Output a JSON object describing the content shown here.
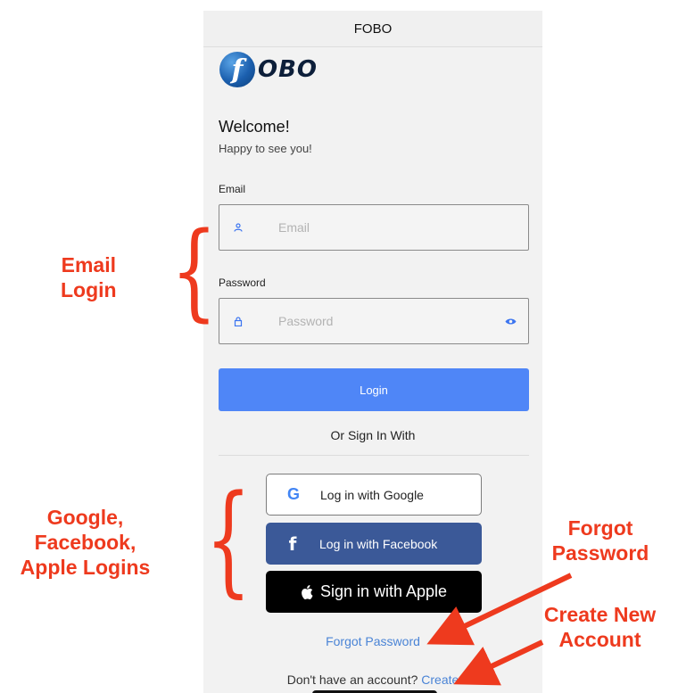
{
  "app": {
    "title": "FOBO",
    "logo_text": "OBO",
    "logo_letter": "f"
  },
  "welcome": {
    "title": "Welcome!",
    "subtitle": "Happy to see you!"
  },
  "email": {
    "label": "Email",
    "placeholder": "Email",
    "icon": "user-icon"
  },
  "password": {
    "label": "Password",
    "placeholder": "Password",
    "icon": "lock-icon",
    "toggle_icon": "eye-icon"
  },
  "login": {
    "label": "Login",
    "color": "#4f86f7"
  },
  "divider_text": "Or Sign In With",
  "social": {
    "google": {
      "label": "Log in with Google",
      "icon_glyph": "G"
    },
    "facebook": {
      "label": "Log in with Facebook",
      "icon_glyph": "f",
      "color": "#3b5998"
    },
    "apple": {
      "label": "Sign in with Apple"
    }
  },
  "forgot": {
    "label": "Forgot Password"
  },
  "create": {
    "prompt": "Don't have an account?",
    "link": "Create"
  },
  "annotations": {
    "email_login": [
      "Email",
      "Login"
    ],
    "social_logins": [
      "Google,",
      "Facebook,",
      "Apple Logins"
    ],
    "forgot_password": [
      "Forgot",
      "Password"
    ],
    "create_account": [
      "Create New",
      "Account"
    ],
    "color": "#ee3a1e"
  }
}
